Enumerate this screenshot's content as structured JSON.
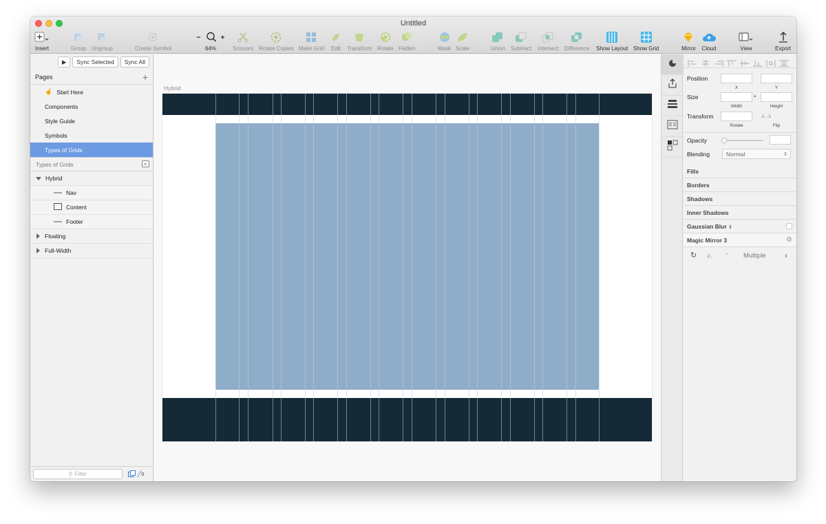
{
  "window": {
    "title": "Untitled"
  },
  "toolbar": {
    "insert": "Insert",
    "group": "Group",
    "ungroup": "Ungroup",
    "create_symbol": "Create Symbol",
    "zoom": "64%",
    "scissors": "Scissors",
    "rotate_copies": "Rotate Copies",
    "make_grid": "Make Grid",
    "edit": "Edit",
    "transform": "Transform",
    "rotate": "Rotate",
    "flatten": "Flatten",
    "mask": "Mask",
    "scale": "Scale",
    "union": "Union",
    "subtract": "Subtract",
    "intersect": "Intersect",
    "difference": "Difference",
    "show_layout": "Show Layout",
    "show_grid": "Show Grid",
    "mirror": "Mirror",
    "cloud": "Cloud",
    "view": "View",
    "export": "Export"
  },
  "sidebar": {
    "sync_selected": "Sync Selected",
    "sync_all": "Sync All",
    "pages_title": "Pages",
    "pages": [
      {
        "label": "Start Here"
      },
      {
        "label": "Components"
      },
      {
        "label": "Style Guide"
      },
      {
        "label": "Symbols"
      },
      {
        "label": "Types of Grids"
      }
    ],
    "layers_title": "Types of Grids",
    "layers": {
      "hybrid": "Hybrid",
      "nav": "Nav",
      "content": "Content",
      "footer": "Footer",
      "floating": "Floating",
      "full_width": "Full-Width"
    },
    "filter_placeholder": "Filter",
    "filter_count": "0"
  },
  "canvas": {
    "artboard_label": "Hybrid"
  },
  "inspector": {
    "position": "Position",
    "x": "X",
    "y": "Y",
    "size": "Size",
    "width": "Width",
    "height": "Height",
    "transform": "Transform",
    "rotate": "Rotate",
    "flip": "Flip",
    "opacity": "Opacity",
    "blending": "Blending",
    "blending_value": "Normal",
    "fills": "Fills",
    "borders": "Borders",
    "shadows": "Shadows",
    "inner_shadows": "Inner Shadows",
    "gaussian_blur": "Gaussian Blur",
    "magic_mirror": "Magic Mirror 3",
    "mirror_mode": "Multiple"
  },
  "colors": {
    "selection": "#6c9ae3",
    "grid_band": "#142a36",
    "grid_content": "#8fadc8"
  }
}
